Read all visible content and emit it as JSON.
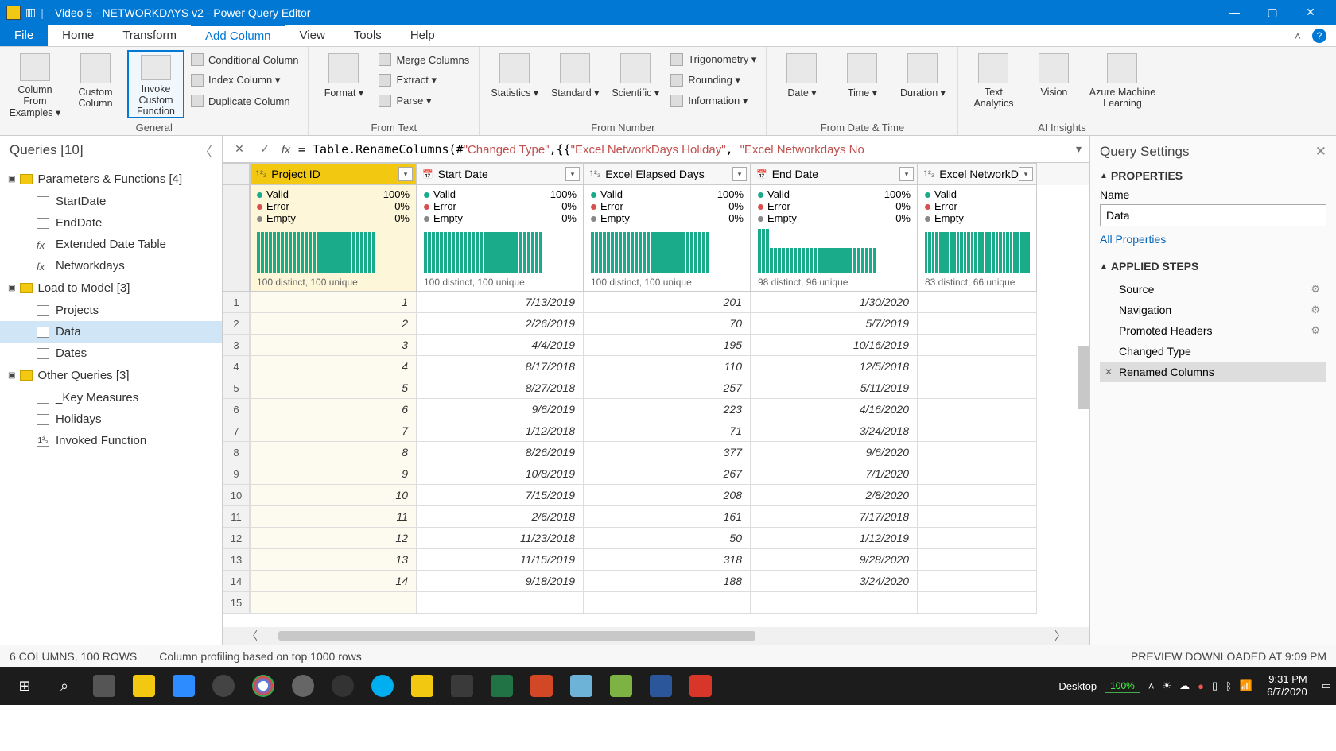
{
  "title": "Video 5 - NETWORKDAYS v2 - Power Query Editor",
  "menu_tabs": [
    "File",
    "Home",
    "Transform",
    "Add Column",
    "View",
    "Tools",
    "Help"
  ],
  "active_tab": "Add Column",
  "ribbon": {
    "groups": {
      "general": {
        "label": "General",
        "big": [
          {
            "label": "Column From Examples ▾"
          },
          {
            "label": "Custom Column"
          },
          {
            "label": "Invoke Custom Function",
            "highlight": true
          }
        ],
        "small": [
          "Conditional Column",
          "Index Column ▾",
          "Duplicate Column"
        ]
      },
      "from_text": {
        "label": "From Text",
        "big": [
          {
            "label": "Format ▾"
          }
        ],
        "small": [
          "Merge Columns",
          "Extract ▾",
          "Parse ▾"
        ]
      },
      "from_number": {
        "label": "From Number",
        "big": [
          {
            "label": "Statistics ▾"
          },
          {
            "label": "Standard ▾"
          },
          {
            "label": "Scientific ▾"
          }
        ],
        "small": [
          "Trigonometry ▾",
          "Rounding ▾",
          "Information ▾"
        ]
      },
      "from_date": {
        "label": "From Date & Time",
        "big": [
          {
            "label": "Date ▾"
          },
          {
            "label": "Time ▾"
          },
          {
            "label": "Duration ▾"
          }
        ]
      },
      "ai": {
        "label": "AI Insights",
        "big": [
          {
            "label": "Text Analytics"
          },
          {
            "label": "Vision"
          },
          {
            "label": "Azure Machine Learning"
          }
        ]
      }
    }
  },
  "queries": {
    "header": "Queries [10]",
    "groups": [
      {
        "label": "Parameters & Functions [4]",
        "items": [
          {
            "label": "StartDate",
            "icon": "table"
          },
          {
            "label": "EndDate",
            "icon": "table"
          },
          {
            "label": "Extended Date Table",
            "icon": "fx"
          },
          {
            "label": "Networkdays",
            "icon": "fx"
          }
        ]
      },
      {
        "label": "Load to Model [3]",
        "items": [
          {
            "label": "Projects",
            "icon": "table"
          },
          {
            "label": "Data",
            "icon": "table",
            "selected": true
          },
          {
            "label": "Dates",
            "icon": "table"
          }
        ]
      },
      {
        "label": "Other Queries [3]",
        "items": [
          {
            "label": "_Key Measures",
            "icon": "table"
          },
          {
            "label": "Holidays",
            "icon": "table"
          },
          {
            "label": "Invoked Function",
            "icon": "123"
          }
        ]
      }
    ]
  },
  "formula": {
    "prefix": "= Table.RenameColumns(#",
    "q1": "\"Changed Type\"",
    "mid": ",{{",
    "s1": "\"Excel NetworkDays  Holiday\"",
    "c": ", ",
    "s2": "\"Excel Networkdays No"
  },
  "columns": [
    {
      "name": "Project ID",
      "type": "1²₃",
      "selected": true,
      "valid": "100%",
      "error": "0%",
      "empty": "0%",
      "distinct": "100 distinct, 100 unique",
      "bars": "full"
    },
    {
      "name": "Start Date",
      "type": "📅",
      "valid": "100%",
      "error": "0%",
      "empty": "0%",
      "distinct": "100 distinct, 100 unique",
      "bars": "full"
    },
    {
      "name": "Excel Elapsed Days",
      "type": "1²₃",
      "valid": "100%",
      "error": "0%",
      "empty": "0%",
      "distinct": "100 distinct, 100 unique",
      "bars": "full"
    },
    {
      "name": "End Date",
      "type": "📅",
      "valid": "100%",
      "error": "0%",
      "empty": "0%",
      "distinct": "98 distinct, 96 unique",
      "bars": "step"
    },
    {
      "name": "Excel NetworkDay",
      "type": "1²₃",
      "valid": "",
      "error": "",
      "empty": "",
      "distinct": "83 distinct, 66 unique",
      "bars": "full",
      "narrow": true
    }
  ],
  "rows": [
    {
      "n": 1,
      "c": [
        "1",
        "7/13/2019",
        "201",
        "1/30/2020",
        ""
      ]
    },
    {
      "n": 2,
      "c": [
        "2",
        "2/26/2019",
        "70",
        "5/7/2019",
        ""
      ]
    },
    {
      "n": 3,
      "c": [
        "3",
        "4/4/2019",
        "195",
        "10/16/2019",
        ""
      ]
    },
    {
      "n": 4,
      "c": [
        "4",
        "8/17/2018",
        "110",
        "12/5/2018",
        ""
      ]
    },
    {
      "n": 5,
      "c": [
        "5",
        "8/27/2018",
        "257",
        "5/11/2019",
        ""
      ]
    },
    {
      "n": 6,
      "c": [
        "6",
        "9/6/2019",
        "223",
        "4/16/2020",
        ""
      ]
    },
    {
      "n": 7,
      "c": [
        "7",
        "1/12/2018",
        "71",
        "3/24/2018",
        ""
      ]
    },
    {
      "n": 8,
      "c": [
        "8",
        "8/26/2019",
        "377",
        "9/6/2020",
        ""
      ]
    },
    {
      "n": 9,
      "c": [
        "9",
        "10/8/2019",
        "267",
        "7/1/2020",
        ""
      ]
    },
    {
      "n": 10,
      "c": [
        "10",
        "7/15/2019",
        "208",
        "2/8/2020",
        ""
      ]
    },
    {
      "n": 11,
      "c": [
        "11",
        "2/6/2018",
        "161",
        "7/17/2018",
        ""
      ]
    },
    {
      "n": 12,
      "c": [
        "12",
        "11/23/2018",
        "50",
        "1/12/2019",
        ""
      ]
    },
    {
      "n": 13,
      "c": [
        "13",
        "11/15/2019",
        "318",
        "9/28/2020",
        ""
      ]
    },
    {
      "n": 14,
      "c": [
        "14",
        "9/18/2019",
        "188",
        "3/24/2020",
        ""
      ]
    },
    {
      "n": 15,
      "c": [
        "",
        "",
        "",
        "",
        ""
      ]
    }
  ],
  "settings": {
    "title": "Query Settings",
    "properties_label": "PROPERTIES",
    "name_label": "Name",
    "name_value": "Data",
    "all_props": "All Properties",
    "steps_label": "APPLIED STEPS",
    "steps": [
      {
        "label": "Source",
        "gear": true
      },
      {
        "label": "Navigation",
        "gear": true
      },
      {
        "label": "Promoted Headers",
        "gear": true
      },
      {
        "label": "Changed Type"
      },
      {
        "label": "Renamed Columns",
        "selected": true,
        "x": true
      }
    ]
  },
  "status": {
    "left": "6 COLUMNS, 100 ROWS",
    "mid": "Column profiling based on top 1000 rows",
    "right": "PREVIEW DOWNLOADED AT 9:09 PM"
  },
  "taskbar": {
    "desktop": "Desktop",
    "battery": "100%",
    "time": "9:31 PM",
    "date": "6/7/2020"
  },
  "labels": {
    "valid": "Valid",
    "error": "Error",
    "empty": "Empty"
  }
}
